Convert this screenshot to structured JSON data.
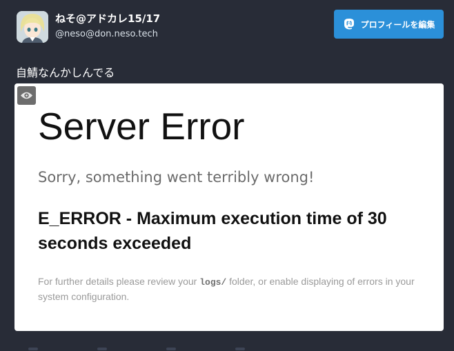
{
  "profile": {
    "display_name": "ねそ@アドカレ15/17",
    "acct": "@neso@don.neso.tech",
    "edit_button_label": "プロフィールを編集"
  },
  "status": {
    "text": "自鯖なんかしんでる"
  },
  "media": {
    "error_page": {
      "title": "Server Error",
      "subtitle": "Sorry, something went terribly wrong!",
      "message": "E_ERROR - Maximum execution time of 30 seconds exceeded",
      "detail_before": "For further details please review your ",
      "detail_code": "logs/",
      "detail_after": " folder, or enable displaying of errors in your system configuration."
    }
  },
  "colors": {
    "background": "#282c37",
    "accent": "#2b90d9"
  },
  "icons": {
    "edit_button": "mastodon-icon",
    "media_toggle": "eye-icon"
  }
}
